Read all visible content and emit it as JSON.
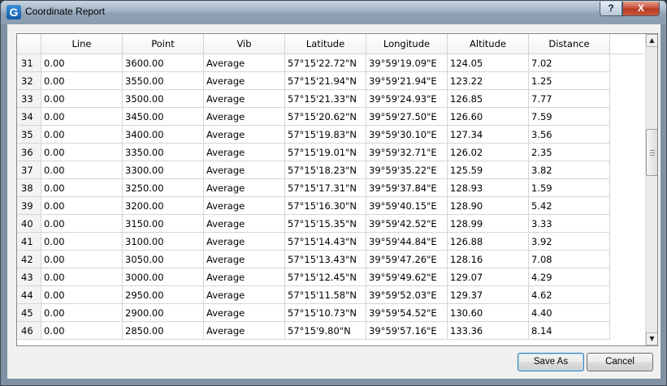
{
  "window": {
    "title": "Coordinate Report",
    "app_icon_letter": "G",
    "help_label": "?",
    "close_label": "X"
  },
  "table": {
    "columns": [
      "Line",
      "Point",
      "Vib",
      "Latitude",
      "Longitude",
      "Altitude",
      "Distance"
    ],
    "rows": [
      {
        "num": "31",
        "cells": [
          "0.00",
          "3600.00",
          "Average",
          "57°15'22.72\"N",
          "39°59'19.09\"E",
          "124.05",
          "7.02"
        ]
      },
      {
        "num": "32",
        "cells": [
          "0.00",
          "3550.00",
          "Average",
          "57°15'21.94\"N",
          "39°59'21.94\"E",
          "123.22",
          "1.25"
        ]
      },
      {
        "num": "33",
        "cells": [
          "0.00",
          "3500.00",
          "Average",
          "57°15'21.33\"N",
          "39°59'24.93\"E",
          "126.85",
          "7.77"
        ]
      },
      {
        "num": "34",
        "cells": [
          "0.00",
          "3450.00",
          "Average",
          "57°15'20.62\"N",
          "39°59'27.50\"E",
          "126.60",
          "7.59"
        ]
      },
      {
        "num": "35",
        "cells": [
          "0.00",
          "3400.00",
          "Average",
          "57°15'19.83\"N",
          "39°59'30.10\"E",
          "127.34",
          "3.56"
        ]
      },
      {
        "num": "36",
        "cells": [
          "0.00",
          "3350.00",
          "Average",
          "57°15'19.01\"N",
          "39°59'32.71\"E",
          "126.02",
          "2.35"
        ]
      },
      {
        "num": "37",
        "cells": [
          "0.00",
          "3300.00",
          "Average",
          "57°15'18.23\"N",
          "39°59'35.22\"E",
          "125.59",
          "3.82"
        ]
      },
      {
        "num": "38",
        "cells": [
          "0.00",
          "3250.00",
          "Average",
          "57°15'17.31\"N",
          "39°59'37.84\"E",
          "128.93",
          "1.59"
        ]
      },
      {
        "num": "39",
        "cells": [
          "0.00",
          "3200.00",
          "Average",
          "57°15'16.30\"N",
          "39°59'40.15\"E",
          "128.90",
          "5.42"
        ]
      },
      {
        "num": "40",
        "cells": [
          "0.00",
          "3150.00",
          "Average",
          "57°15'15.35\"N",
          "39°59'42.52\"E",
          "128.99",
          "3.33"
        ]
      },
      {
        "num": "41",
        "cells": [
          "0.00",
          "3100.00",
          "Average",
          "57°15'14.43\"N",
          "39°59'44.84\"E",
          "126.88",
          "3.92"
        ]
      },
      {
        "num": "42",
        "cells": [
          "0.00",
          "3050.00",
          "Average",
          "57°15'13.43\"N",
          "39°59'47.26\"E",
          "128.16",
          "7.08"
        ]
      },
      {
        "num": "43",
        "cells": [
          "0.00",
          "3000.00",
          "Average",
          "57°15'12.45\"N",
          "39°59'49.62\"E",
          "129.07",
          "4.29"
        ]
      },
      {
        "num": "44",
        "cells": [
          "0.00",
          "2950.00",
          "Average",
          "57°15'11.58\"N",
          "39°59'52.03\"E",
          "129.37",
          "4.62"
        ]
      },
      {
        "num": "45",
        "cells": [
          "0.00",
          "2900.00",
          "Average",
          "57°15'10.73\"N",
          "39°59'54.52\"E",
          "130.60",
          "4.40"
        ]
      },
      {
        "num": "46",
        "cells": [
          "0.00",
          "2850.00",
          "Average",
          "57°15'9.80\"N",
          "39°59'57.16\"E",
          "133.36",
          "8.14"
        ]
      }
    ]
  },
  "scrollbar": {
    "up_icon": "triangle-up",
    "down_icon": "triangle-down"
  },
  "buttons": {
    "save_as": "Save As",
    "cancel": "Cancel"
  },
  "colors": {
    "title_bar": "#9fb1c2",
    "close_button": "#c9533c",
    "default_button_border": "#3c7fb1"
  }
}
